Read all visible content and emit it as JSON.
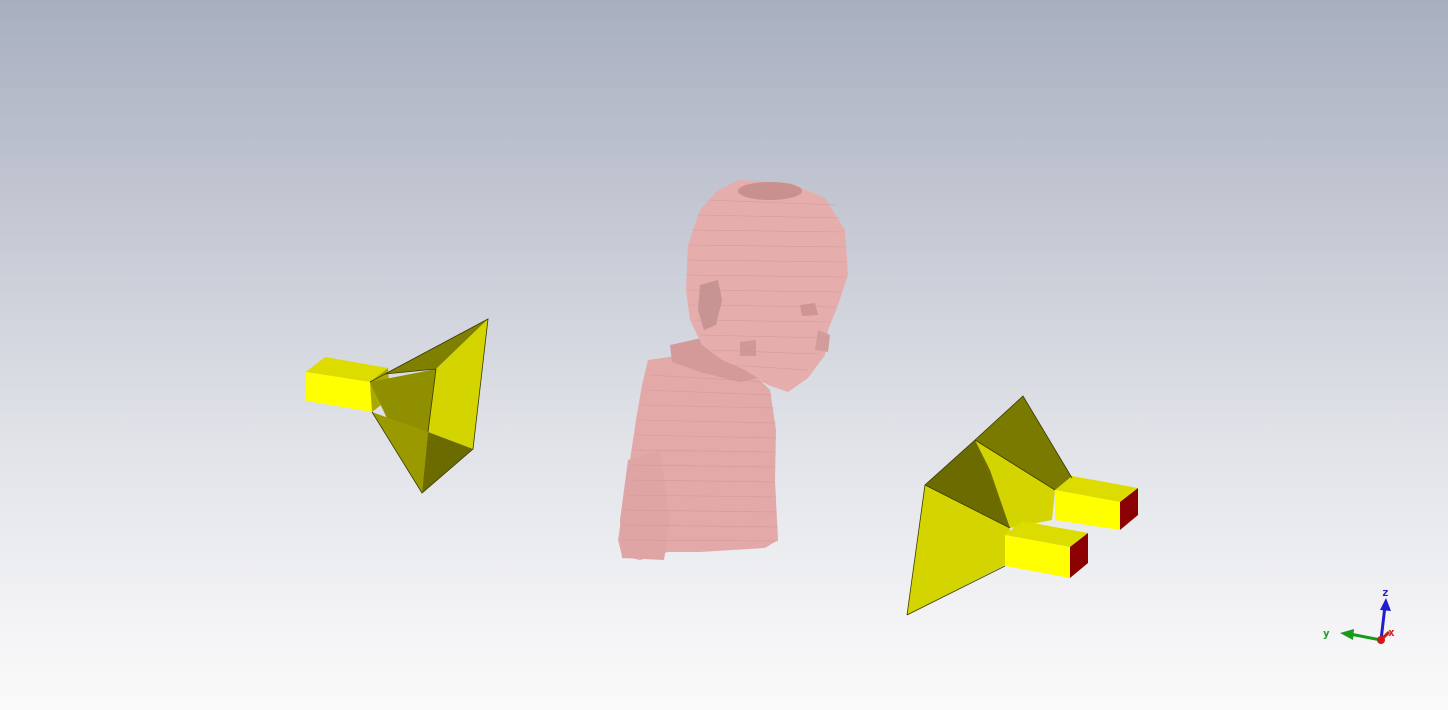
{
  "axes": {
    "z_label": "z",
    "y_label": "y",
    "x_label": "x",
    "colors": {
      "z": "#1f1fd0",
      "y": "#1a9a1a",
      "x": "#d01a1a"
    }
  },
  "scene": {
    "model_color": "#e3a9a9",
    "horn_color_light": "#d4d400",
    "horn_color_mid": "#8f8f00",
    "horn_color_dark": "#6b6b00",
    "port_color": "#8b0000",
    "waveguide_color": "#ffff00"
  }
}
